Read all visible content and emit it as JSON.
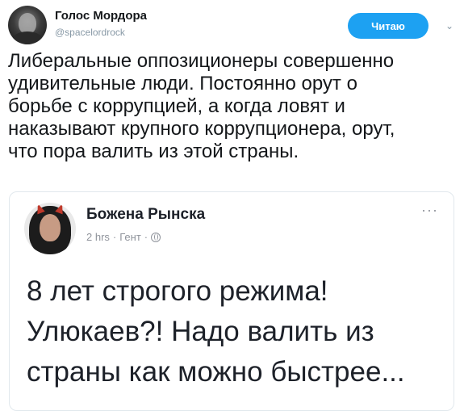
{
  "tweet": {
    "author_name": "Голос Мордора",
    "author_handle": "@spacelordrock",
    "follow_label": "Читаю",
    "text": "Либеральные оппозиционеры совершенно\nудивительные люди. Постоянно орут о\nборьбе с коррупцией, а когда ловят и\nнаказывают крупного коррупционера, орут,\nчто пора валить из этой страны."
  },
  "quoted_post": {
    "author_name": "Божена Рынска",
    "time": "2 hrs",
    "location": "Гент",
    "separator": "·",
    "more_label": "···",
    "text": "8 лет строгого режима!\nУлюкаев?! Надо валить из\nстраны как можно быстрее..."
  },
  "icons": {
    "caret": "chevron-down-icon",
    "privacy": "globe-icon",
    "more": "more-dots-icon"
  },
  "colors": {
    "follow_button": "#1da1f2",
    "muted_text": "#8899a6",
    "card_border": "#e1e8ed"
  }
}
